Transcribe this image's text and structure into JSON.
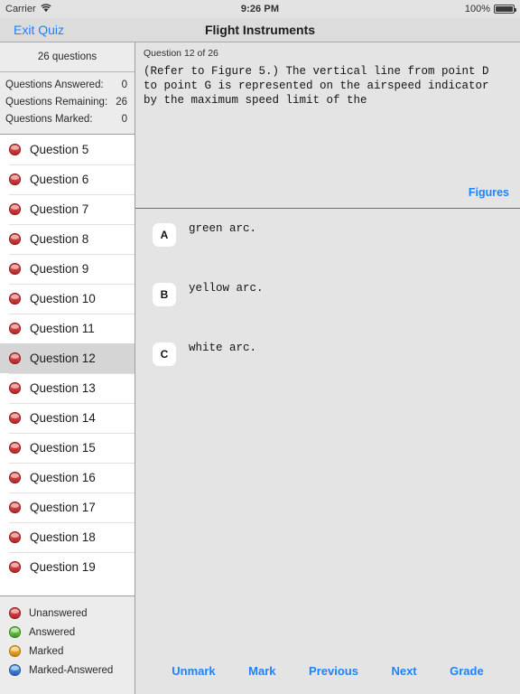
{
  "status_bar": {
    "carrier": "Carrier",
    "wifi_icon": "wifi-icon",
    "time": "9:26 PM",
    "battery_percent": "100%",
    "battery_icon": "battery-full-icon"
  },
  "nav_bar": {
    "back_label": "Exit Quiz",
    "title": "Flight Instruments"
  },
  "sidebar": {
    "header": "26 questions",
    "stats": [
      {
        "label": "Questions Answered:",
        "value": "0"
      },
      {
        "label": "Questions Remaining:",
        "value": "26"
      },
      {
        "label": "Questions Marked:",
        "value": "0"
      }
    ],
    "questions": [
      {
        "label": "Question 5",
        "state": "red",
        "selected": false
      },
      {
        "label": "Question 6",
        "state": "red",
        "selected": false
      },
      {
        "label": "Question 7",
        "state": "red",
        "selected": false
      },
      {
        "label": "Question 8",
        "state": "red",
        "selected": false
      },
      {
        "label": "Question 9",
        "state": "red",
        "selected": false
      },
      {
        "label": "Question 10",
        "state": "red",
        "selected": false
      },
      {
        "label": "Question 11",
        "state": "red",
        "selected": false
      },
      {
        "label": "Question 12",
        "state": "red",
        "selected": true
      },
      {
        "label": "Question 13",
        "state": "red",
        "selected": false
      },
      {
        "label": "Question 14",
        "state": "red",
        "selected": false
      },
      {
        "label": "Question 15",
        "state": "red",
        "selected": false
      },
      {
        "label": "Question 16",
        "state": "red",
        "selected": false
      },
      {
        "label": "Question 17",
        "state": "red",
        "selected": false
      },
      {
        "label": "Question 18",
        "state": "red",
        "selected": false
      },
      {
        "label": "Question 19",
        "state": "red",
        "selected": false
      }
    ],
    "legend": [
      {
        "label": "Unanswered",
        "state": "red"
      },
      {
        "label": "Answered",
        "state": "green"
      },
      {
        "label": "Marked",
        "state": "orange"
      },
      {
        "label": "Marked-Answered",
        "state": "blue"
      }
    ]
  },
  "question_panel": {
    "meta": "Question 12 of 26",
    "text": "(Refer to Figure 5.) The vertical line from point D\nto point G is represented on the airspeed indicator\nby the maximum speed limit of the",
    "figures_label": "Figures"
  },
  "answers": [
    {
      "letter": "A",
      "text": "green arc."
    },
    {
      "letter": "B",
      "text": "yellow arc."
    },
    {
      "letter": "C",
      "text": "white arc."
    }
  ],
  "toolbar": [
    {
      "label": "Unmark"
    },
    {
      "label": "Mark"
    },
    {
      "label": "Previous"
    },
    {
      "label": "Next"
    },
    {
      "label": "Grade"
    }
  ],
  "colors": {
    "accent_blue": "#1e83ff",
    "panel_bg": "#e4e4e4",
    "sidebar_bg": "#ececec",
    "list_bg": "#ffffff",
    "selected_row": "#d5d5d5"
  }
}
